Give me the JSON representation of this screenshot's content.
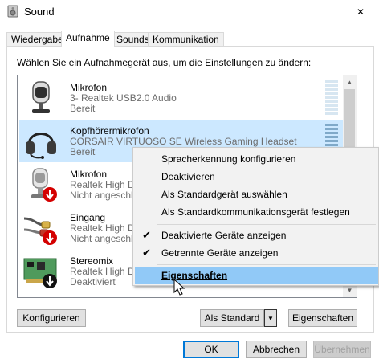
{
  "window": {
    "title": "Sound",
    "close_symbol": "✕"
  },
  "tabs": [
    {
      "label": "Wiedergabe",
      "active": false
    },
    {
      "label": "Aufnahme",
      "active": true
    },
    {
      "label": "Sounds",
      "active": false
    },
    {
      "label": "Kommunikation",
      "active": false
    }
  ],
  "instruction": "Wählen Sie ein Aufnahmegerät aus, um die Einstellungen zu ändern:",
  "devices": [
    {
      "name": "Mikrofon",
      "desc": "3- Realtek USB2.0 Audio",
      "status": "Bereit",
      "icon": "microphone-icon",
      "selected": false
    },
    {
      "name": "Kopfhörermikrofon",
      "desc": "CORSAIR VIRTUOSO SE Wireless Gaming Headset",
      "status": "Bereit",
      "icon": "headset-icon",
      "selected": true
    },
    {
      "name": "Mikrofon",
      "desc": "Realtek High De",
      "status": "Nicht angeschlo",
      "icon": "microphone-disconnected-icon",
      "selected": false
    },
    {
      "name": "Eingang",
      "desc": "Realtek High De",
      "status": "Nicht angeschlo",
      "icon": "line-in-disconnected-icon",
      "selected": false
    },
    {
      "name": "Stereomix",
      "desc": "Realtek High De",
      "status": "Deaktiviert",
      "icon": "soundcard-disabled-icon",
      "selected": false
    }
  ],
  "context_menu": {
    "items": [
      {
        "label": "Spracherkennung konfigurieren"
      },
      {
        "label": "Deaktivieren"
      },
      {
        "label": "Als Standardgerät auswählen"
      },
      {
        "label": "Als Standardkommunikationsgerät festlegen"
      },
      {
        "label": "Deaktivierte Geräte anzeigen",
        "checked": true
      },
      {
        "label": "Getrennte Geräte anzeigen",
        "checked": true
      },
      {
        "label": "Eigenschaften",
        "highlighted": true
      }
    ],
    "check_symbol": "✔"
  },
  "buttons": {
    "configure": "Konfigurieren",
    "set_default": "Als Standard",
    "properties": "Eigenschaften",
    "ok": "OK",
    "cancel": "Abbrechen",
    "apply": "Übernehmen"
  },
  "colors": {
    "selection": "#cce8ff",
    "menu_highlight": "#91c9f7",
    "accent": "#0078d7"
  }
}
